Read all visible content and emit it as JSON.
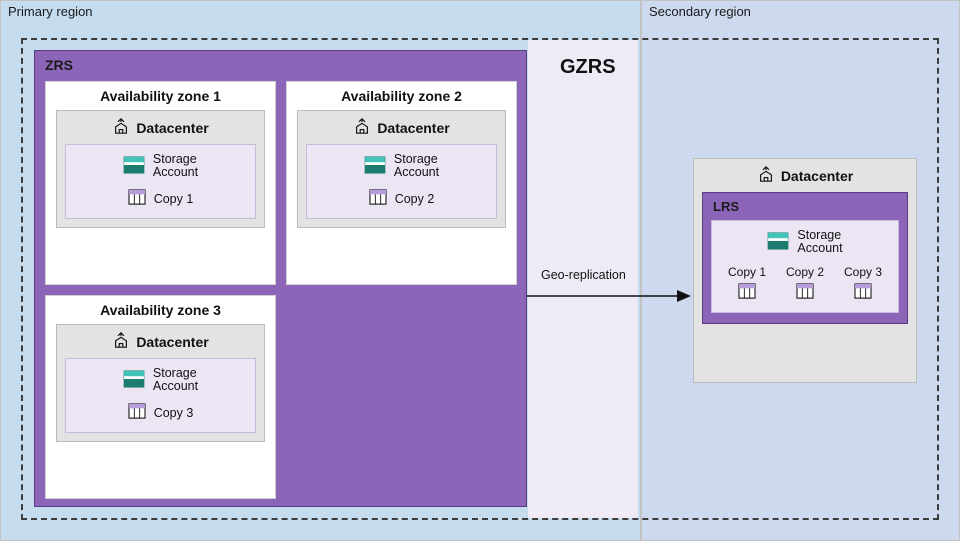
{
  "regions": {
    "primary": "Primary region",
    "secondary": "Secondary region"
  },
  "gzrs": "GZRS",
  "zrs": {
    "title": "ZRS",
    "zones": [
      {
        "title": "Availability zone 1",
        "datacenter": "Datacenter",
        "storage": "Storage\nAccount",
        "copy": "Copy 1"
      },
      {
        "title": "Availability zone 2",
        "datacenter": "Datacenter",
        "storage": "Storage\nAccount",
        "copy": "Copy 2"
      },
      {
        "title": "Availability zone 3",
        "datacenter": "Datacenter",
        "storage": "Storage\nAccount",
        "copy": "Copy 3"
      }
    ]
  },
  "replication_label": "Geo-replication",
  "lrs": {
    "datacenter": "Datacenter",
    "title": "LRS",
    "storage": "Storage\nAccount",
    "copies": [
      "Copy 1",
      "Copy 2",
      "Copy 3"
    ]
  }
}
